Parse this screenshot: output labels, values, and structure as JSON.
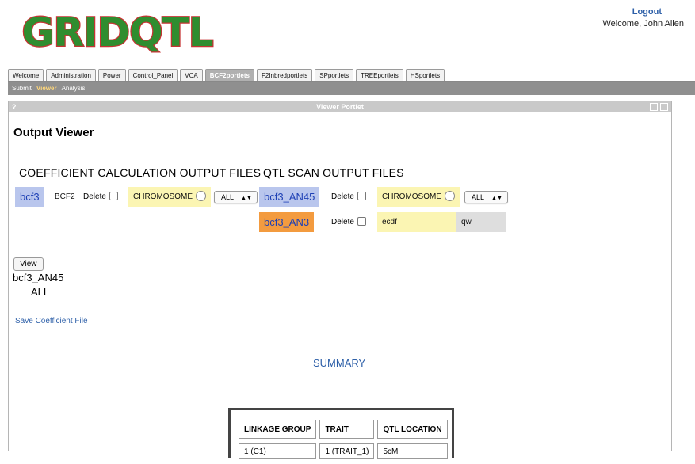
{
  "logo": {
    "text": "GRIDQTL",
    "color": "#2f8d2f",
    "outline": "#c63333"
  },
  "user": {
    "logout_label": "Logout",
    "welcome_text": "Welcome, John Allen"
  },
  "tabs": [
    {
      "label": "Welcome",
      "active": false
    },
    {
      "label": "Administration",
      "active": false
    },
    {
      "label": "Power",
      "active": false
    },
    {
      "label": "Control_Panel",
      "active": false
    },
    {
      "label": "VCA",
      "active": false
    },
    {
      "label": "BCF2portlets",
      "active": true
    },
    {
      "label": "F2Inbredportlets",
      "active": false
    },
    {
      "label": "SPportlets",
      "active": false
    },
    {
      "label": "TREEportlets",
      "active": false
    },
    {
      "label": "HSportlets",
      "active": false
    }
  ],
  "subnav": {
    "submit": "Submit",
    "viewer": "Viewer",
    "analysis": "Analysis"
  },
  "portlet": {
    "help": "?",
    "title": "Viewer Portlet",
    "heading": "Output Viewer",
    "coef_section": {
      "title": "COEFFICIENT CALCULATION OUTPUT FILES",
      "file": "bcf3",
      "type": "BCF2",
      "delete_label": "Delete",
      "chromosome_label": "CHROMOSOME",
      "select_value": "ALL"
    },
    "qtl_section": {
      "title": "QTL SCAN OUTPUT FILES",
      "rows": [
        {
          "file": "bcf3_AN45",
          "delete_label": "Delete",
          "chromosome_label": "CHROMOSOME",
          "select_value": "ALL"
        },
        {
          "file": "bcf3_AN3",
          "delete_label": "Delete",
          "field_value": "ecdf",
          "extra_value": "qw"
        }
      ]
    },
    "view_button": "View",
    "result_file": "bcf3_AN45",
    "result_scope": "ALL",
    "save_link": "Save Coefficient File",
    "summary_label": "SUMMARY",
    "summary_table": {
      "headers": [
        "LINKAGE GROUP",
        "TRAIT",
        "QTL LOCATION"
      ],
      "rows": [
        [
          "1 (C1)",
          "1 (TRAIT_1)",
          "5cM"
        ]
      ]
    }
  }
}
